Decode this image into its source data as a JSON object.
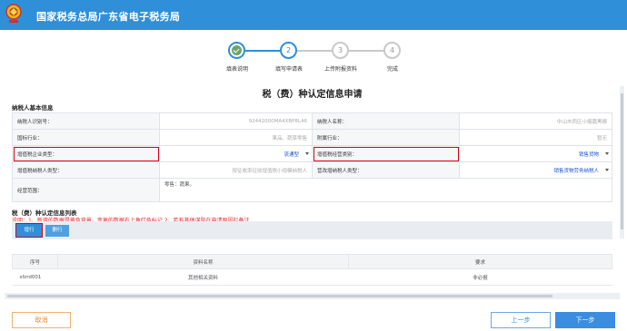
{
  "header": {
    "title": "国家税务总局广东省电子税务局"
  },
  "steps": [
    {
      "num": "",
      "label": "填表说明"
    },
    {
      "num": "2",
      "label": "填写申请表"
    },
    {
      "num": "3",
      "label": "上传附报资料"
    },
    {
      "num": "4",
      "label": "完成"
    }
  ],
  "form": {
    "title": "税（费）种认定信息申请",
    "basic_section": "纳税人基本信息",
    "rows": [
      {
        "l1": "纳税人识别号：",
        "v1": "92442000MA4XBP8L46",
        "l2": "纳税人名称：",
        "v2": "中山市西区小楠嘉黑粮"
      },
      {
        "l1": "国标行业：",
        "v1": "果品、蔬菜零售",
        "l2": "附属行业：",
        "v2": "暂无"
      },
      {
        "l1": "增值税企业类型：",
        "v1": "流通型",
        "l2": "增值税经营类别：",
        "v2": "销售货物"
      },
      {
        "l1": "增值税纳税人类型：",
        "v1": "按征收率征收增值税小规模纳税人",
        "l2": "营改增纳税人类型：",
        "v2": "销售货物劳务纳税人"
      },
      {
        "l1": "经营范围：",
        "v1": "零售：蔬果。"
      }
    ],
    "list_section": "税（费）种认定信息列表",
    "hint": "说明：1、新增的数据是黄色背景，变更的数据右上角红色标记 2、若有其他谋型在申请原因栏备注",
    "add_label": "增行",
    "delete_label": "删行"
  },
  "grid": {
    "headers": [
      "序号",
      "资料名称",
      "要求"
    ],
    "rows": [
      {
        "id": "sfzrd001",
        "name": "其他相关资料",
        "req": "非必报"
      }
    ]
  },
  "footer": {
    "cancel": "取消",
    "prev": "上一步",
    "next": "下一步"
  },
  "colors": {
    "brand": "#2f8fd8",
    "warning": "#d9001b"
  }
}
